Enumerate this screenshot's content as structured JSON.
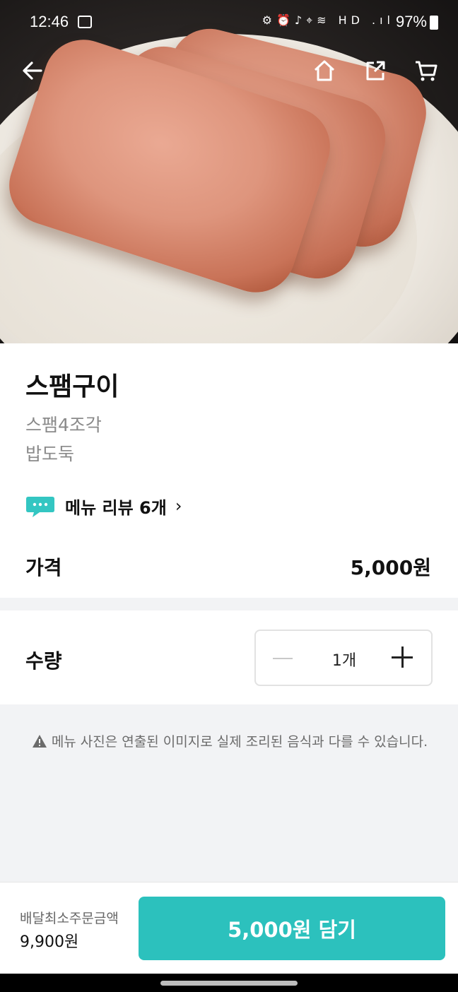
{
  "status_bar": {
    "time": "12:46",
    "battery": "97%",
    "icons": "⚙⏰♪⌖≋ HD .ıl"
  },
  "nav": {
    "back_icon": "arrow-left-icon",
    "home_icon": "home-icon",
    "share_icon": "share-icon",
    "cart_icon": "cart-icon"
  },
  "product": {
    "title": "스팸구이",
    "description_lines": [
      "스팸4조각",
      "밥도둑"
    ],
    "review_label": "메뉴 리뷰 6개",
    "price_label": "가격",
    "price": "5,000원"
  },
  "quantity": {
    "label": "수량",
    "value": "1개"
  },
  "notice": "메뉴 사진은 연출된 이미지로 실제 조리된 음식과 다를 수 있습니다.",
  "bottom_bar": {
    "min_order_label": "배달최소주문금액",
    "min_order_value": "9,900원",
    "add_button": "5,000원 담기"
  },
  "colors": {
    "accent": "#2cc1bd",
    "text": "#111111",
    "muted": "#8a8a8a",
    "background": "#f2f3f5"
  }
}
